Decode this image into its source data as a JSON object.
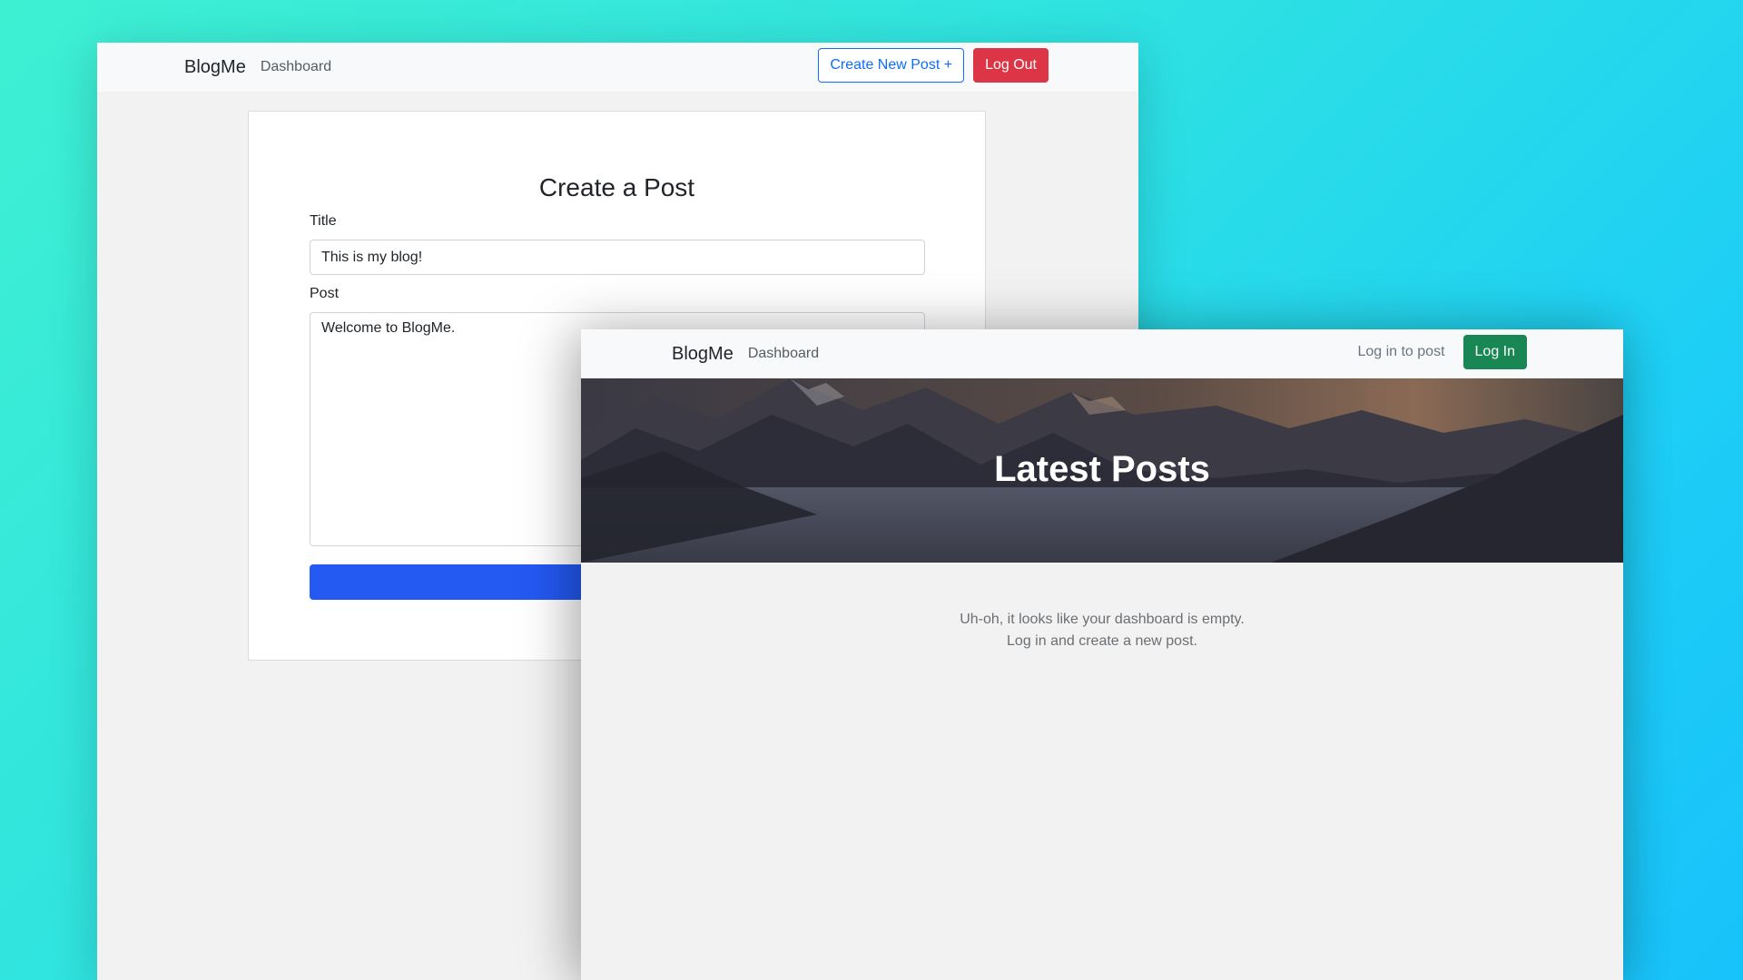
{
  "create_window": {
    "navbar": {
      "brand": "BlogMe",
      "dashboard_link": "Dashboard",
      "create_post_button": "Create New Post +",
      "logout_button": "Log Out"
    },
    "form": {
      "heading": "Create a Post",
      "title_label": "Title",
      "title_value": "This is my blog!",
      "post_label": "Post",
      "post_value": "Welcome to BlogMe."
    }
  },
  "posts_window": {
    "navbar": {
      "brand": "BlogMe",
      "dashboard_link": "Dashboard",
      "login_prompt": "Log in to post",
      "login_button": "Log In"
    },
    "hero": {
      "title": "Latest Posts"
    },
    "empty_state": {
      "line1": "Uh-oh, it looks like your dashboard is empty.",
      "line2": "Log in and create a new post."
    }
  },
  "colors": {
    "primary": "#0d6efd",
    "danger": "#dc3545",
    "success": "#198754",
    "submit": "#2459f2"
  }
}
